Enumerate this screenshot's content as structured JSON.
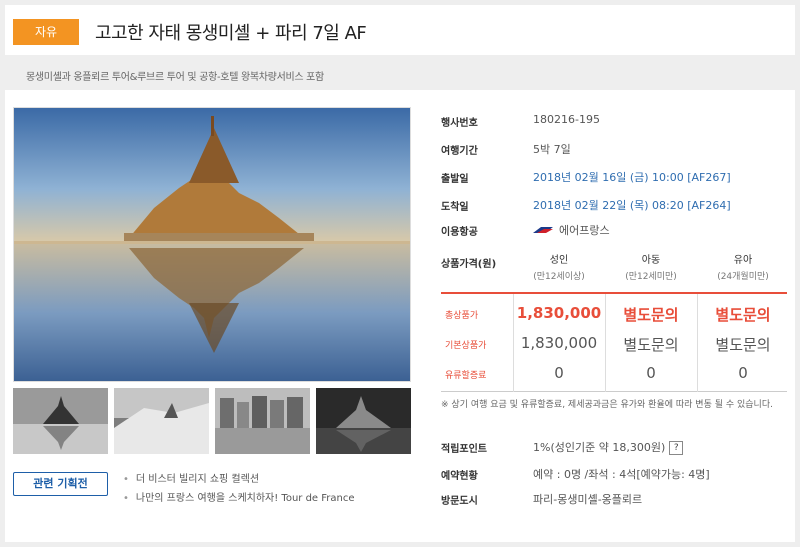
{
  "header": {
    "tag": "자유",
    "title": "고고한 자태 몽생미셸 + 파리 7일 AF",
    "subtitle": "몽생미셸과 옹플뢰르 투어&루브르 투어 및 공항-호텔 왕복차량서비스 포함"
  },
  "info": {
    "code_label": "행사번호",
    "code": "180216-195",
    "period_label": "여행기간",
    "period": "5박 7일",
    "depart_label": "출발일",
    "depart": "2018년 02월 16일 (금) 10:00 [AF267]",
    "arrive_label": "도착일",
    "arrive": "2018년 02월 22일 (목) 08:20 [AF264]",
    "airline_label": "이용항공",
    "airline": "에어프랑스",
    "price_label": "상품가격(원)",
    "cols": [
      {
        "name": "성인",
        "sub": "(만12세이상)"
      },
      {
        "name": "아동",
        "sub": "(만12세미만)"
      },
      {
        "name": "유아",
        "sub": "(24개월미만)"
      }
    ],
    "rows": [
      {
        "label": "총상품가",
        "values": [
          "1,830,000",
          "별도문의",
          "별도문의"
        ]
      },
      {
        "label": "기본상품가",
        "values": [
          "1,830,000",
          "별도문의",
          "별도문의"
        ]
      },
      {
        "label": "유류할증료",
        "values": [
          "0",
          "0",
          "0"
        ]
      }
    ],
    "note": "※ 상기 여행 요금 및 유류할증료, 제세공과금은 유가와 환율에 따라 변동 될 수 있습니다.",
    "points_label": "적립포인트",
    "points": "1%(성인기준 약 18,300원)",
    "points_help": "?",
    "reserve_label": "예약현황",
    "reserve": "예약 : 0명 /좌석 : 4석[예약가능: 4명]",
    "cities_label": "방문도시",
    "cities": "파리-몽생미셸-옹플뢰르"
  },
  "related": {
    "button": "관련 기획전",
    "items": [
      "더 비스터 빌리지 쇼핑 컬렉션",
      "나만의 프랑스 여행을 스케치하자! Tour de France"
    ]
  },
  "colors": {
    "accent": "#f39422",
    "price_red": "#e84e3a",
    "link_blue": "#2f6db0"
  }
}
